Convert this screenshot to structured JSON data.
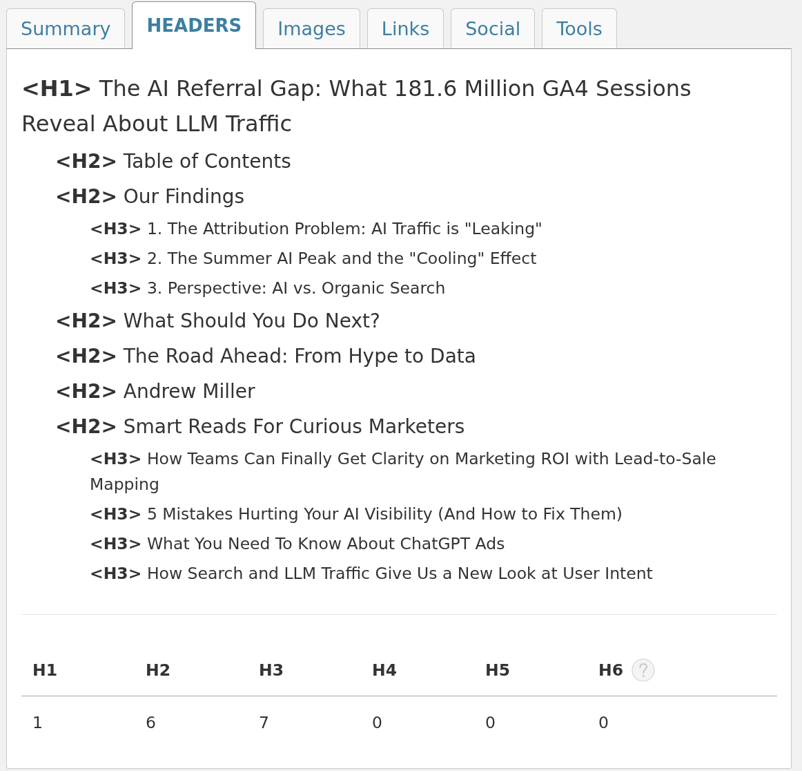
{
  "tabs": [
    {
      "label": "Summary",
      "selected": false
    },
    {
      "label": "HEADERS",
      "selected": true
    },
    {
      "label": "Images",
      "selected": false
    },
    {
      "label": "Links",
      "selected": false
    },
    {
      "label": "Social",
      "selected": false
    },
    {
      "label": "Tools",
      "selected": false
    }
  ],
  "headings": [
    {
      "text": "**<H1>** The AI Referral Gap: What 181.6 Million GA4 Sessions Reveal About LLM Traffic",
      "children": [
        {
          "text": "**<H2>** Table of Contents"
        },
        {
          "text": "**<H2>** Our Findings",
          "children": [
            {
              "text": "**<H3>** 1. The Attribution Problem: AI Traffic is \"Leaking\""
            },
            {
              "text": "**<H3>** 2. The Summer AI Peak and the \"Cooling\" Effect"
            },
            {
              "text": "**<H3>** 3. Perspective: AI vs. Organic Search"
            }
          ]
        },
        {
          "text": "**<H2>** What Should You Do Next?"
        },
        {
          "text": "**<H2>** The Road Ahead: From Hype to Data"
        },
        {
          "text": "**<H2>** Andrew Miller"
        },
        {
          "text": "**<H2>** Smart Reads For Curious Marketers",
          "children": [
            {
              "text": "**<H3>** How Teams Can Finally Get Clarity on Marketing ROI with Lead-to-Sale Mapping"
            },
            {
              "text": "**<H3>** 5 Mistakes Hurting Your AI Visibility (And How to Fix Them)"
            },
            {
              "text": "**<H3>** What You Need To Know About ChatGPT Ads"
            },
            {
              "text": "**<H3>** How Search and LLM Traffic Give Us a New Look at User Intent"
            }
          ]
        }
      ]
    }
  ],
  "counts": [
    {
      "label": "H1",
      "value": "1",
      "help": false
    },
    {
      "label": "H2",
      "value": "6",
      "help": false
    },
    {
      "label": "H3",
      "value": "7",
      "help": false
    },
    {
      "label": "H4",
      "value": "0",
      "help": false
    },
    {
      "label": "H5",
      "value": "0",
      "help": false
    },
    {
      "label": "H6",
      "value": "0",
      "help": true
    }
  ]
}
